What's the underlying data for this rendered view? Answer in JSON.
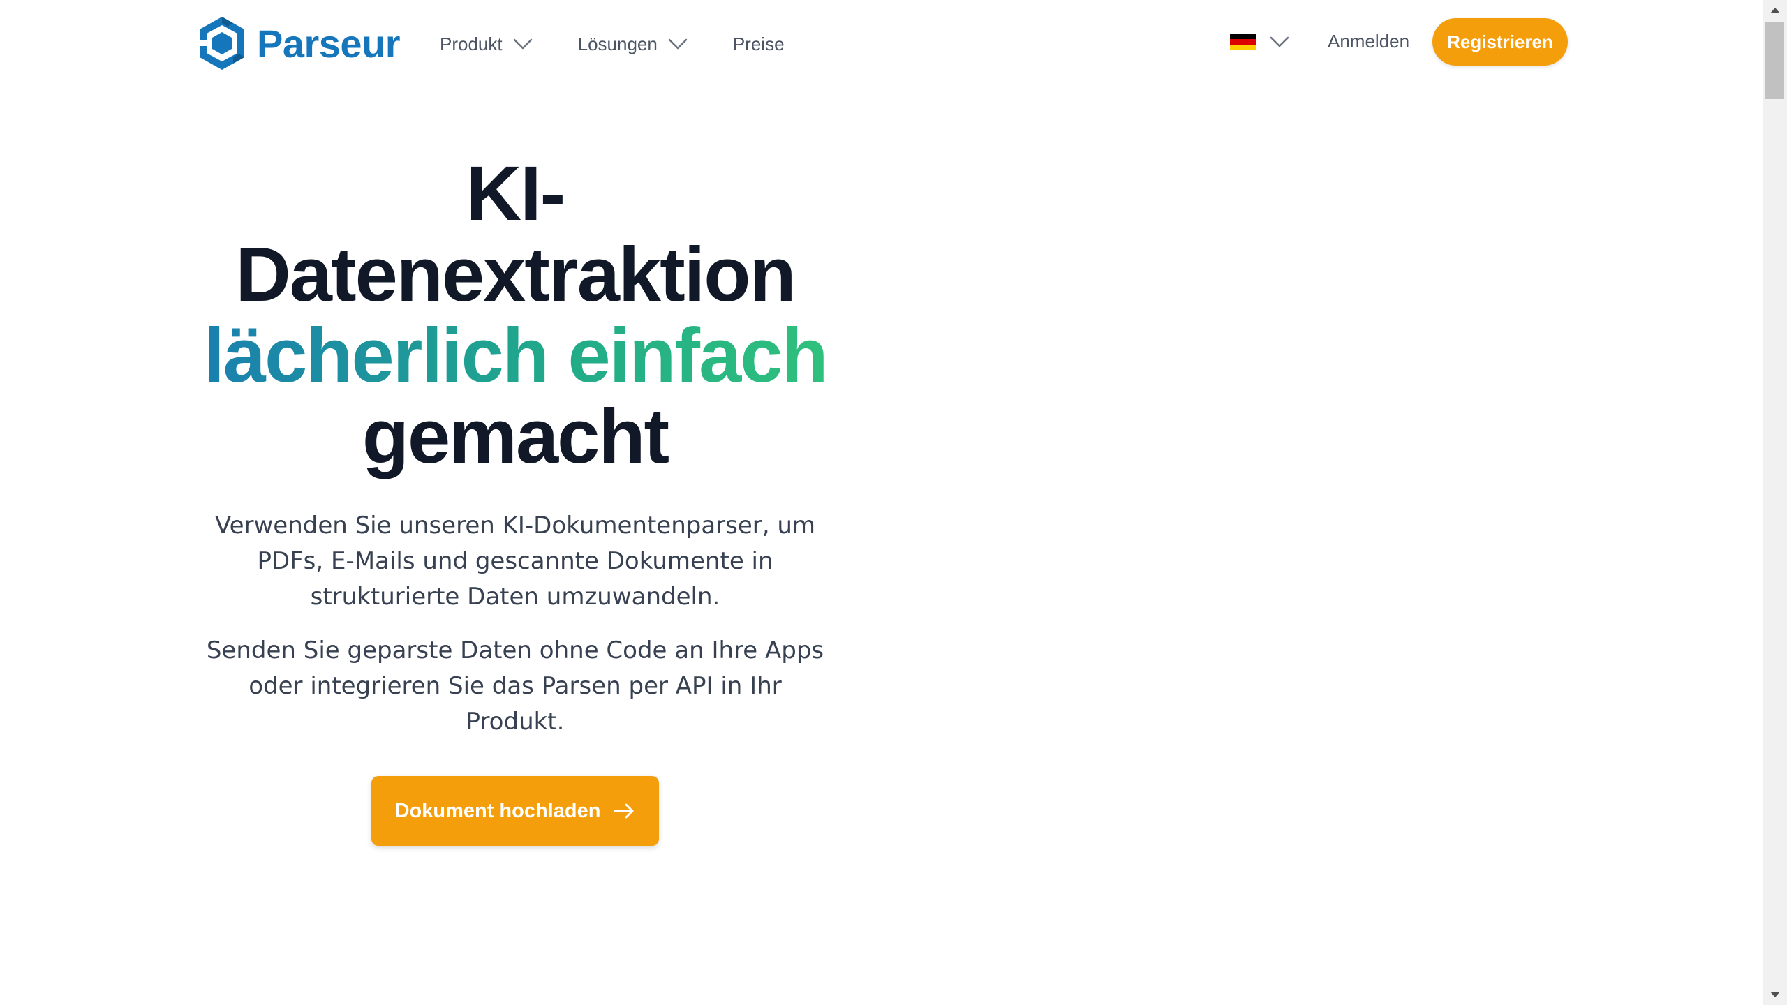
{
  "brand": {
    "name": "Parseur",
    "color": "#1676bb"
  },
  "nav": {
    "product": "Produkt",
    "solutions": "Lösungen",
    "pricing": "Preise"
  },
  "header_right": {
    "language_flag": "german-flag-icon",
    "login": "Anmelden",
    "register": "Registrieren"
  },
  "hero": {
    "headline_line1": "KI-",
    "headline_line2": "Datenextraktion",
    "headline_accent": "lächerlich einfach",
    "headline_line4": "gemacht",
    "paragraph1": "Verwenden Sie unseren KI-Dokumentenparser, um PDFs, E-Mails und gescannte Dokumente in strukturierte Daten umzuwandeln.",
    "paragraph2": "Senden Sie geparste Daten ohne Code an Ihre Apps oder integrieren Sie das Parsen per API in Ihr Produkt.",
    "cta_label": "Dokument hochladen"
  },
  "colors": {
    "accent_orange": "#f59e0b",
    "headline_dark": "#111827",
    "gradient_start": "#1a7fb0",
    "gradient_end": "#2fc17c"
  }
}
